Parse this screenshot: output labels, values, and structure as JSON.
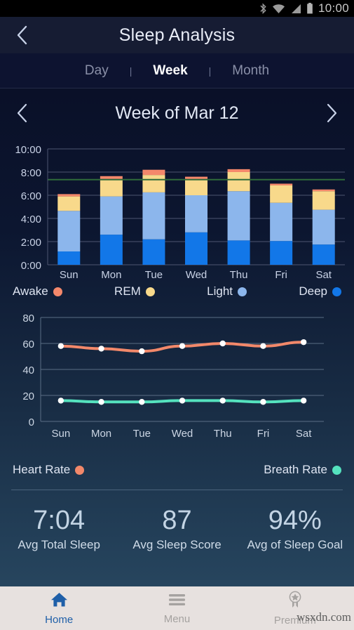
{
  "status_bar": {
    "time": "10:00",
    "icons": [
      "bluetooth-icon",
      "wifi-icon",
      "cell-signal-icon",
      "battery-icon"
    ]
  },
  "header": {
    "title": "Sleep Analysis",
    "back_icon": "chevron-left-icon"
  },
  "range_tabs": {
    "items": [
      {
        "label": "Day",
        "active": false
      },
      {
        "label": "Week",
        "active": true
      },
      {
        "label": "Month",
        "active": false
      }
    ],
    "separator": "|"
  },
  "week_nav": {
    "prev_icon": "chevron-left-icon",
    "next_icon": "chevron-right-icon",
    "label": "Week of Mar 12"
  },
  "sleep_legend": [
    {
      "label": "Awake",
      "color": "#f4886b"
    },
    {
      "label": "REM",
      "color": "#f8d98b"
    },
    {
      "label": "Light",
      "color": "#8cb6ec"
    },
    {
      "label": "Deep",
      "color": "#1277e8"
    }
  ],
  "vitals_legend": [
    {
      "label": "Heart Rate",
      "color": "#f2886a"
    },
    {
      "label": "Breath Rate",
      "color": "#55e2be"
    }
  ],
  "summary": [
    {
      "value": "7:04",
      "label": "Avg Total Sleep"
    },
    {
      "value": "87",
      "label": "Avg Sleep Score"
    },
    {
      "value": "94%",
      "label": "Avg of Sleep Goal"
    }
  ],
  "bottom_nav": [
    {
      "label": "Home",
      "icon": "home-icon",
      "active": true
    },
    {
      "label": "Menu",
      "icon": "hamburger-menu-icon",
      "active": false
    },
    {
      "label": "Premium",
      "icon": "award-ribbon-icon",
      "active": false
    }
  ],
  "watermark": "wsxdn.com",
  "chart_data": [
    {
      "type": "bar",
      "id": "sleep-stages-bar-chart",
      "title": "",
      "stacked": true,
      "categories": [
        "Sun",
        "Mon",
        "Tue",
        "Wed",
        "Thu",
        "Fri",
        "Sat"
      ],
      "ylabel": "",
      "xlabel": "",
      "ylim": [
        0,
        10
      ],
      "yticks": [
        0,
        2,
        4,
        6,
        8,
        10
      ],
      "ytick_labels": [
        "0:00",
        "2:00",
        "4:00",
        "6:00",
        "8:00",
        "10:00"
      ],
      "grid": true,
      "goal_line": {
        "value": 7.35,
        "color": "#2f6b3a",
        "label": ""
      },
      "series": [
        {
          "name": "Deep",
          "color": "#1277e8",
          "values": [
            1.15,
            2.6,
            2.2,
            2.8,
            2.1,
            2.05,
            1.75
          ]
        },
        {
          "name": "Light",
          "color": "#8cb6ec",
          "values": [
            3.5,
            3.3,
            4.05,
            3.2,
            4.25,
            3.3,
            3.0
          ]
        },
        {
          "name": "REM",
          "color": "#f8d98b",
          "values": [
            1.25,
            1.5,
            1.5,
            1.4,
            1.65,
            1.5,
            1.6
          ]
        },
        {
          "name": "Awake",
          "color": "#f4886b",
          "values": [
            0.2,
            0.25,
            0.45,
            0.2,
            0.25,
            0.15,
            0.15
          ]
        }
      ],
      "totals": [
        6.1,
        7.65,
        8.2,
        7.6,
        8.25,
        7.0,
        6.5
      ]
    },
    {
      "type": "line",
      "id": "vitals-line-chart",
      "title": "",
      "categories": [
        "Sun",
        "Mon",
        "Tue",
        "Wed",
        "Thu",
        "Fri",
        "Sat"
      ],
      "ylim": [
        0,
        80
      ],
      "yticks": [
        0,
        20,
        40,
        60,
        80
      ],
      "ytick_labels": [
        "0",
        "20",
        "40",
        "60",
        "80"
      ],
      "grid": true,
      "markers": true,
      "series": [
        {
          "name": "Heart Rate",
          "color": "#f2886a",
          "values": [
            58,
            56,
            54,
            58,
            60,
            58,
            61
          ]
        },
        {
          "name": "Breath Rate",
          "color": "#55e2be",
          "values": [
            16,
            15,
            15,
            16,
            16,
            15,
            16
          ]
        }
      ]
    }
  ]
}
